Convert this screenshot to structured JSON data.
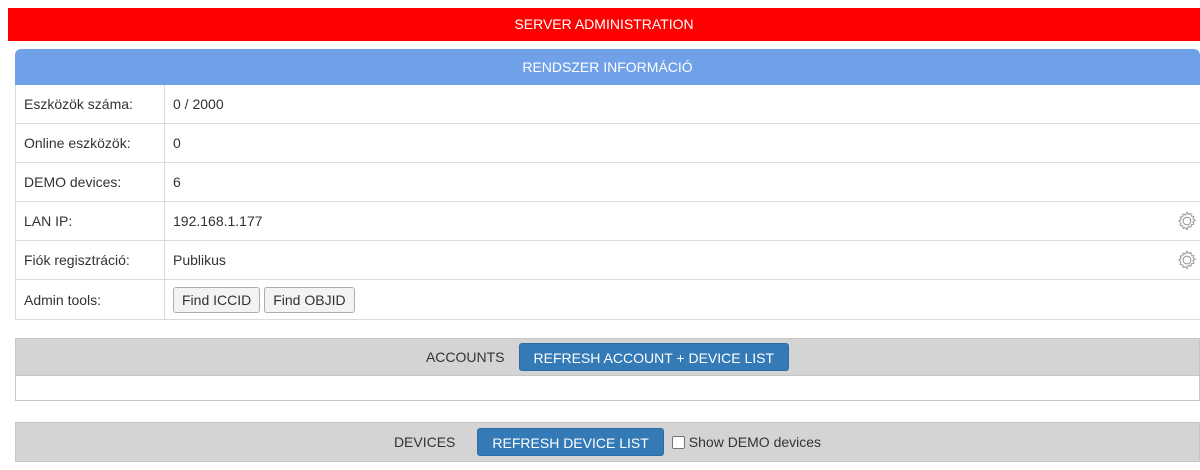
{
  "header": {
    "title": "SERVER ADMINISTRATION"
  },
  "system_info": {
    "title": "RENDSZER INFORMÁCIÓ",
    "rows": [
      {
        "label": "Eszközök száma:",
        "value": "0 / 2000"
      },
      {
        "label": "Online eszközök:",
        "value": "0"
      },
      {
        "label": "DEMO devices:",
        "value": "6"
      },
      {
        "label": "LAN IP:",
        "value": "192.168.1.177"
      },
      {
        "label": "Fiók regisztráció:",
        "value": "Publikus"
      }
    ],
    "admin_tools": {
      "label": "Admin tools:",
      "find_iccid": "Find ICCID",
      "find_objid": "Find OBJID"
    }
  },
  "accounts": {
    "label": "ACCOUNTS",
    "refresh_button": "REFRESH ACCOUNT + DEVICE LIST"
  },
  "devices": {
    "label": "DEVICES",
    "refresh_button": "REFRESH DEVICE LIST",
    "show_demo_label": "Show DEMO devices",
    "show_demo_checked": false
  },
  "colors": {
    "banner": "#ff0000",
    "panel_header": "#6fa0e8",
    "primary_button": "#337ab7",
    "section_header": "#d4d4d4"
  },
  "icons": {
    "settings": "gear-icon"
  }
}
